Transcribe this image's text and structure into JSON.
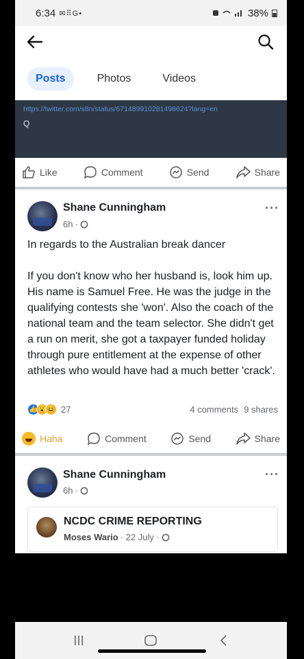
{
  "status_bar": {
    "time": "6:34",
    "left_icons": "✉ ⠿ G •",
    "battery": "38%"
  },
  "header": {
    "back_icon": "arrow-left-icon",
    "search_icon": "search-icon"
  },
  "tabs": [
    {
      "label": "Posts",
      "active": true
    },
    {
      "label": "Photos",
      "active": false
    },
    {
      "label": "Videos",
      "active": false
    }
  ],
  "link_preview": {
    "url": "https://twitter.com/s8n/status/671489910281498624?lang=en",
    "q": "Q"
  },
  "actions_top": {
    "like": "Like",
    "comment": "Comment",
    "send": "Send",
    "share": "Share"
  },
  "post1": {
    "author": "Shane Cunningham",
    "time": "6h ·",
    "paragraph1": "In regards to the Australian break dancer",
    "paragraph2": "If you don't know who her husband is, look him up. His name is Samuel Free. He was the judge in the qualifying contests she 'won'. Also the coach of the national team and the team selector. She didn't get a run on merit, she got a taxpayer funded holiday through pure entitlement at the expense of other athletes who would have had a much better 'crack'.",
    "reaction_count": "27",
    "comments": "4 comments",
    "shares": "9 shares"
  },
  "actions_post1": {
    "reaction": "Haha",
    "comment": "Comment",
    "send": "Send",
    "share": "Share"
  },
  "post2": {
    "author": "Shane Cunningham",
    "time": "6h ·",
    "shared_card": {
      "title": "NCDC CRIME REPORTING",
      "author": "Moses Wario",
      "date": "· 22 July ·"
    }
  },
  "colors": {
    "accent": "#1b64d6",
    "haha": "#e9a02b",
    "link_bg": "#2d3844"
  }
}
